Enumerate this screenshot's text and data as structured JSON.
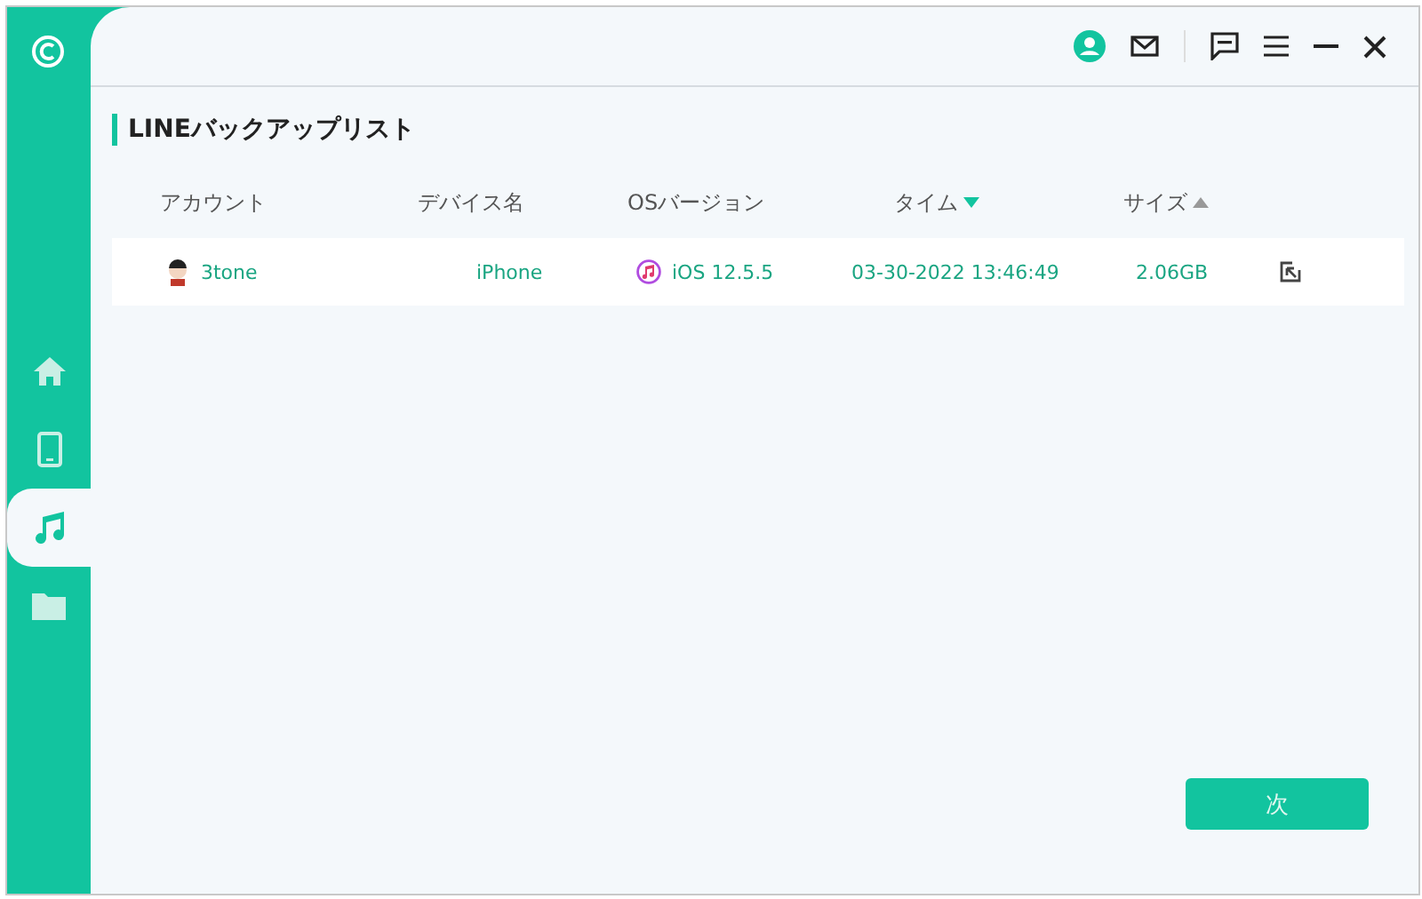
{
  "sidebar": {
    "items": [
      {
        "kind": "home",
        "selected": false
      },
      {
        "kind": "phone",
        "selected": false
      },
      {
        "kind": "music",
        "selected": true
      },
      {
        "kind": "folder",
        "selected": false
      }
    ]
  },
  "title": "LINEバックアップリスト",
  "table": {
    "columns": [
      {
        "label": "アカウント"
      },
      {
        "label": "デバイス名"
      },
      {
        "label": "OSバージョン"
      },
      {
        "label": "タイム",
        "sortable": true,
        "descending": true,
        "active": true
      },
      {
        "label": "サイズ",
        "sortable": true,
        "descending": false,
        "active": false
      }
    ],
    "rows": [
      {
        "account": "3tone",
        "device": "iPhone",
        "os": "iOS 12.5.5",
        "time": "03-30-2022 13:46:49",
        "size": "2.06GB"
      }
    ]
  },
  "next_button": "次"
}
